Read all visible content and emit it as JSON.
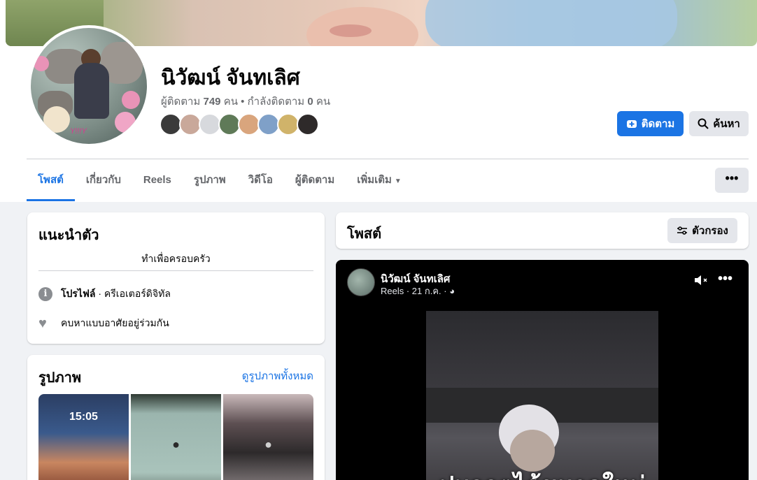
{
  "profile": {
    "name": "นิวัฒน์ จันทเลิศ",
    "followers_label": "ผู้ติดตาม",
    "followers_count": "749",
    "followers_unit": "คน",
    "following_label": "• กำลังติดตาม",
    "following_count": "0",
    "following_unit": "คน",
    "avatar_signature": "Y!!!Y"
  },
  "actions": {
    "follow_label": "ติดตาม",
    "search_label": "ค้นหา"
  },
  "tabs": [
    {
      "label": "โพสต์"
    },
    {
      "label": "เกี่ยวกับ"
    },
    {
      "label": "Reels"
    },
    {
      "label": "รูปภาพ"
    },
    {
      "label": "วิดีโอ"
    },
    {
      "label": "ผู้ติดตาม"
    },
    {
      "label": "เพิ่มเติม"
    }
  ],
  "more_button": "•••",
  "intro": {
    "title": "แนะนำตัว",
    "bio": "ทำเพื่อครอบครัว",
    "profile_label": "โปรไฟล์",
    "profile_value": " · ครีเอเตอร์ดิจิทัล",
    "looking_for": "คบหาแบบอาศัยอยู่ร่วมกัน"
  },
  "photos": {
    "title": "รูปภาพ",
    "see_all": "ดูรูปภาพทั้งหมด",
    "clock": "15:05"
  },
  "posts": {
    "title": "โพสต์",
    "filter_label": "ตัวกรอง"
  },
  "reel": {
    "author": "นิวัฒน์ จันทเลิศ",
    "meta": "Reels · 21 ก.ค. ·",
    "caption": "ปมจกตไต้ขนาดใหม่"
  },
  "colors": {
    "accent": "#1b74e4",
    "page_bg": "#f0f2f5",
    "muted_text": "#65676b"
  }
}
